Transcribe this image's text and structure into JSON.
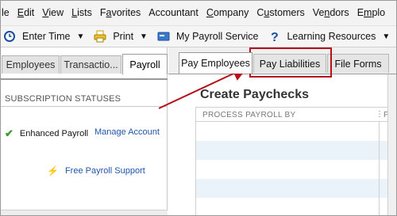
{
  "menubar": {
    "items": [
      {
        "label": "le",
        "u": "l"
      },
      {
        "label": "Edit",
        "u": "E"
      },
      {
        "label": "View",
        "u": "V"
      },
      {
        "label": "Lists",
        "u": "L"
      },
      {
        "label": "Favorites",
        "u": "a"
      },
      {
        "label": "Accountant",
        "u": ""
      },
      {
        "label": "Company",
        "u": "C"
      },
      {
        "label": "Customers",
        "u": "u"
      },
      {
        "label": "Vendors",
        "u": "V"
      },
      {
        "label": "Emplo",
        "u": "E"
      }
    ]
  },
  "toolbar": {
    "enter_time": "Enter Time",
    "print": "Print",
    "my_payroll": "My Payroll Service",
    "learning": "Learning Resources"
  },
  "left_tabs": [
    "Employees",
    "Transactio...",
    "Payroll"
  ],
  "left_panel": {
    "subscription_header": "SUBSCRIPTION STATUSES",
    "enhanced_payroll": "Enhanced Payroll",
    "manage_account": "Manage Account",
    "free_support": "Free Payroll Support"
  },
  "right_tabs": [
    "Pay Employees",
    "Pay Liabilities",
    "File Forms"
  ],
  "content": {
    "title": "Create Paychecks",
    "col1": "PROCESS PAYROLL BY",
    "col2": "PAY"
  },
  "colors": {
    "highlight": "#b5121b",
    "link": "#2255aa",
    "check": "#3a9b2b"
  }
}
